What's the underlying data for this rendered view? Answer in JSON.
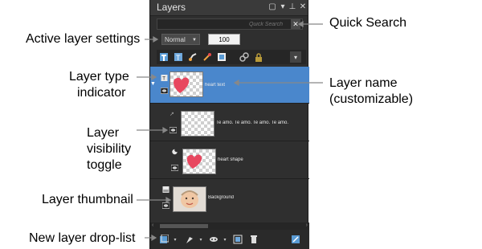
{
  "panel": {
    "title": "Layers",
    "search_placeholder": "Quick Search",
    "blend_mode": "Normal",
    "opacity": "100",
    "layers": [
      {
        "name": "heart text",
        "type": "text",
        "selected": true
      },
      {
        "name": "Te amo. Te amo. Te amo. Te amo.",
        "type": "vector",
        "selected": false
      },
      {
        "name": "heart shape",
        "type": "shape",
        "selected": false
      },
      {
        "name": "Background",
        "type": "raster",
        "selected": false
      }
    ]
  },
  "callouts": {
    "quick_search": "Quick Search",
    "active_layer_settings": "Active layer settings",
    "layer_type_indicator_1": "Layer type",
    "layer_type_indicator_2": "indicator",
    "layer_name_1": "Layer name",
    "layer_name_2": "(customizable)",
    "visibility_1": "Layer",
    "visibility_2": "visibility",
    "visibility_3": "toggle",
    "thumbnail": "Layer thumbnail",
    "new_layer": "New layer drop-list"
  },
  "colors": {
    "panel_bg": "#2f2f2f",
    "selected_row": "#4a87cc",
    "heart": "#e8475f"
  }
}
